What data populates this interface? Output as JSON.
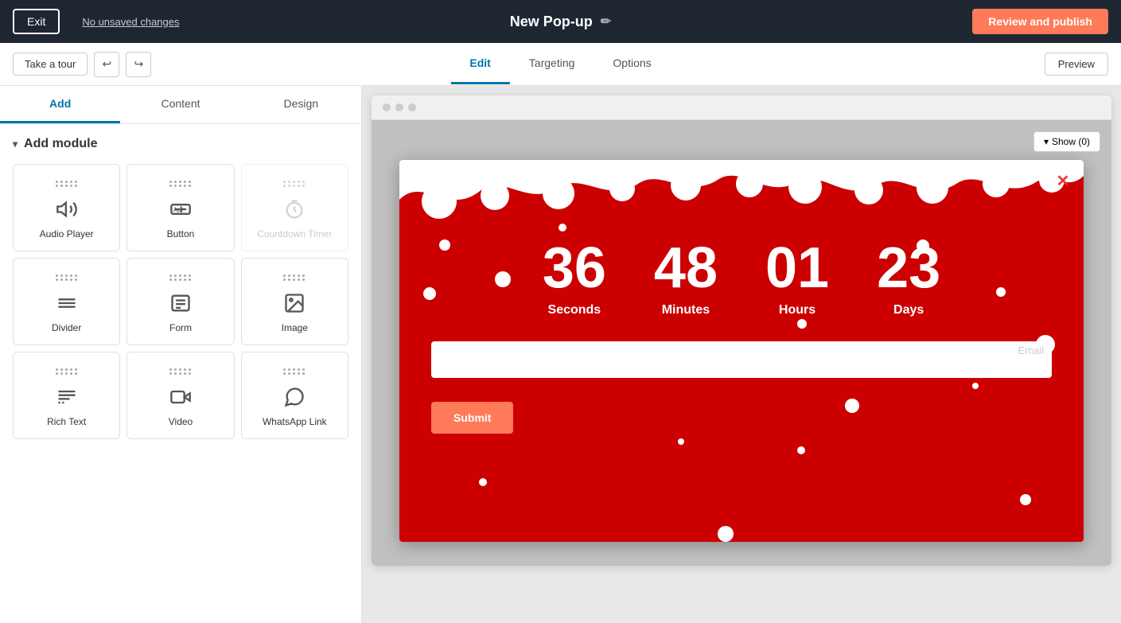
{
  "header": {
    "exit_label": "Exit",
    "unsaved_changes": "No unsaved changes",
    "popup_title": "New Pop-up",
    "review_publish": "Review and publish"
  },
  "sub_header": {
    "take_tour": "Take a tour",
    "tabs": [
      {
        "id": "edit",
        "label": "Edit",
        "active": true
      },
      {
        "id": "targeting",
        "label": "Targeting",
        "active": false
      },
      {
        "id": "options",
        "label": "Options",
        "active": false
      }
    ],
    "preview": "Preview"
  },
  "left_panel": {
    "tabs": [
      {
        "id": "add",
        "label": "Add",
        "active": true
      },
      {
        "id": "content",
        "label": "Content",
        "active": false
      },
      {
        "id": "design",
        "label": "Design",
        "active": false
      }
    ],
    "add_module_label": "Add module",
    "modules": [
      {
        "id": "audio-player",
        "label": "Audio Player",
        "icon": "audio",
        "disabled": false
      },
      {
        "id": "button",
        "label": "Button",
        "icon": "button",
        "disabled": false
      },
      {
        "id": "countdown-timer",
        "label": "Countdown Timer",
        "icon": "clock",
        "disabled": true
      },
      {
        "id": "divider",
        "label": "Divider",
        "icon": "divider",
        "disabled": false
      },
      {
        "id": "form",
        "label": "Form",
        "icon": "form",
        "disabled": false
      },
      {
        "id": "image",
        "label": "Image",
        "icon": "image",
        "disabled": false
      },
      {
        "id": "rich-text",
        "label": "Rich Text",
        "icon": "richtext",
        "disabled": false
      },
      {
        "id": "video",
        "label": "Video",
        "icon": "video",
        "disabled": false
      },
      {
        "id": "whatsapp-link",
        "label": "WhatsApp Link",
        "icon": "whatsapp",
        "disabled": false
      }
    ]
  },
  "canvas": {
    "show_button": "Show (0)",
    "popup": {
      "close_icon": "✕",
      "countdown": {
        "seconds": "36",
        "minutes": "48",
        "hours": "01",
        "days": "23",
        "seconds_label": "Seconds",
        "minutes_label": "Minutes",
        "hours_label": "Hours",
        "days_label": "Days"
      },
      "email_placeholder": "Email",
      "submit_label": "Submit"
    }
  }
}
